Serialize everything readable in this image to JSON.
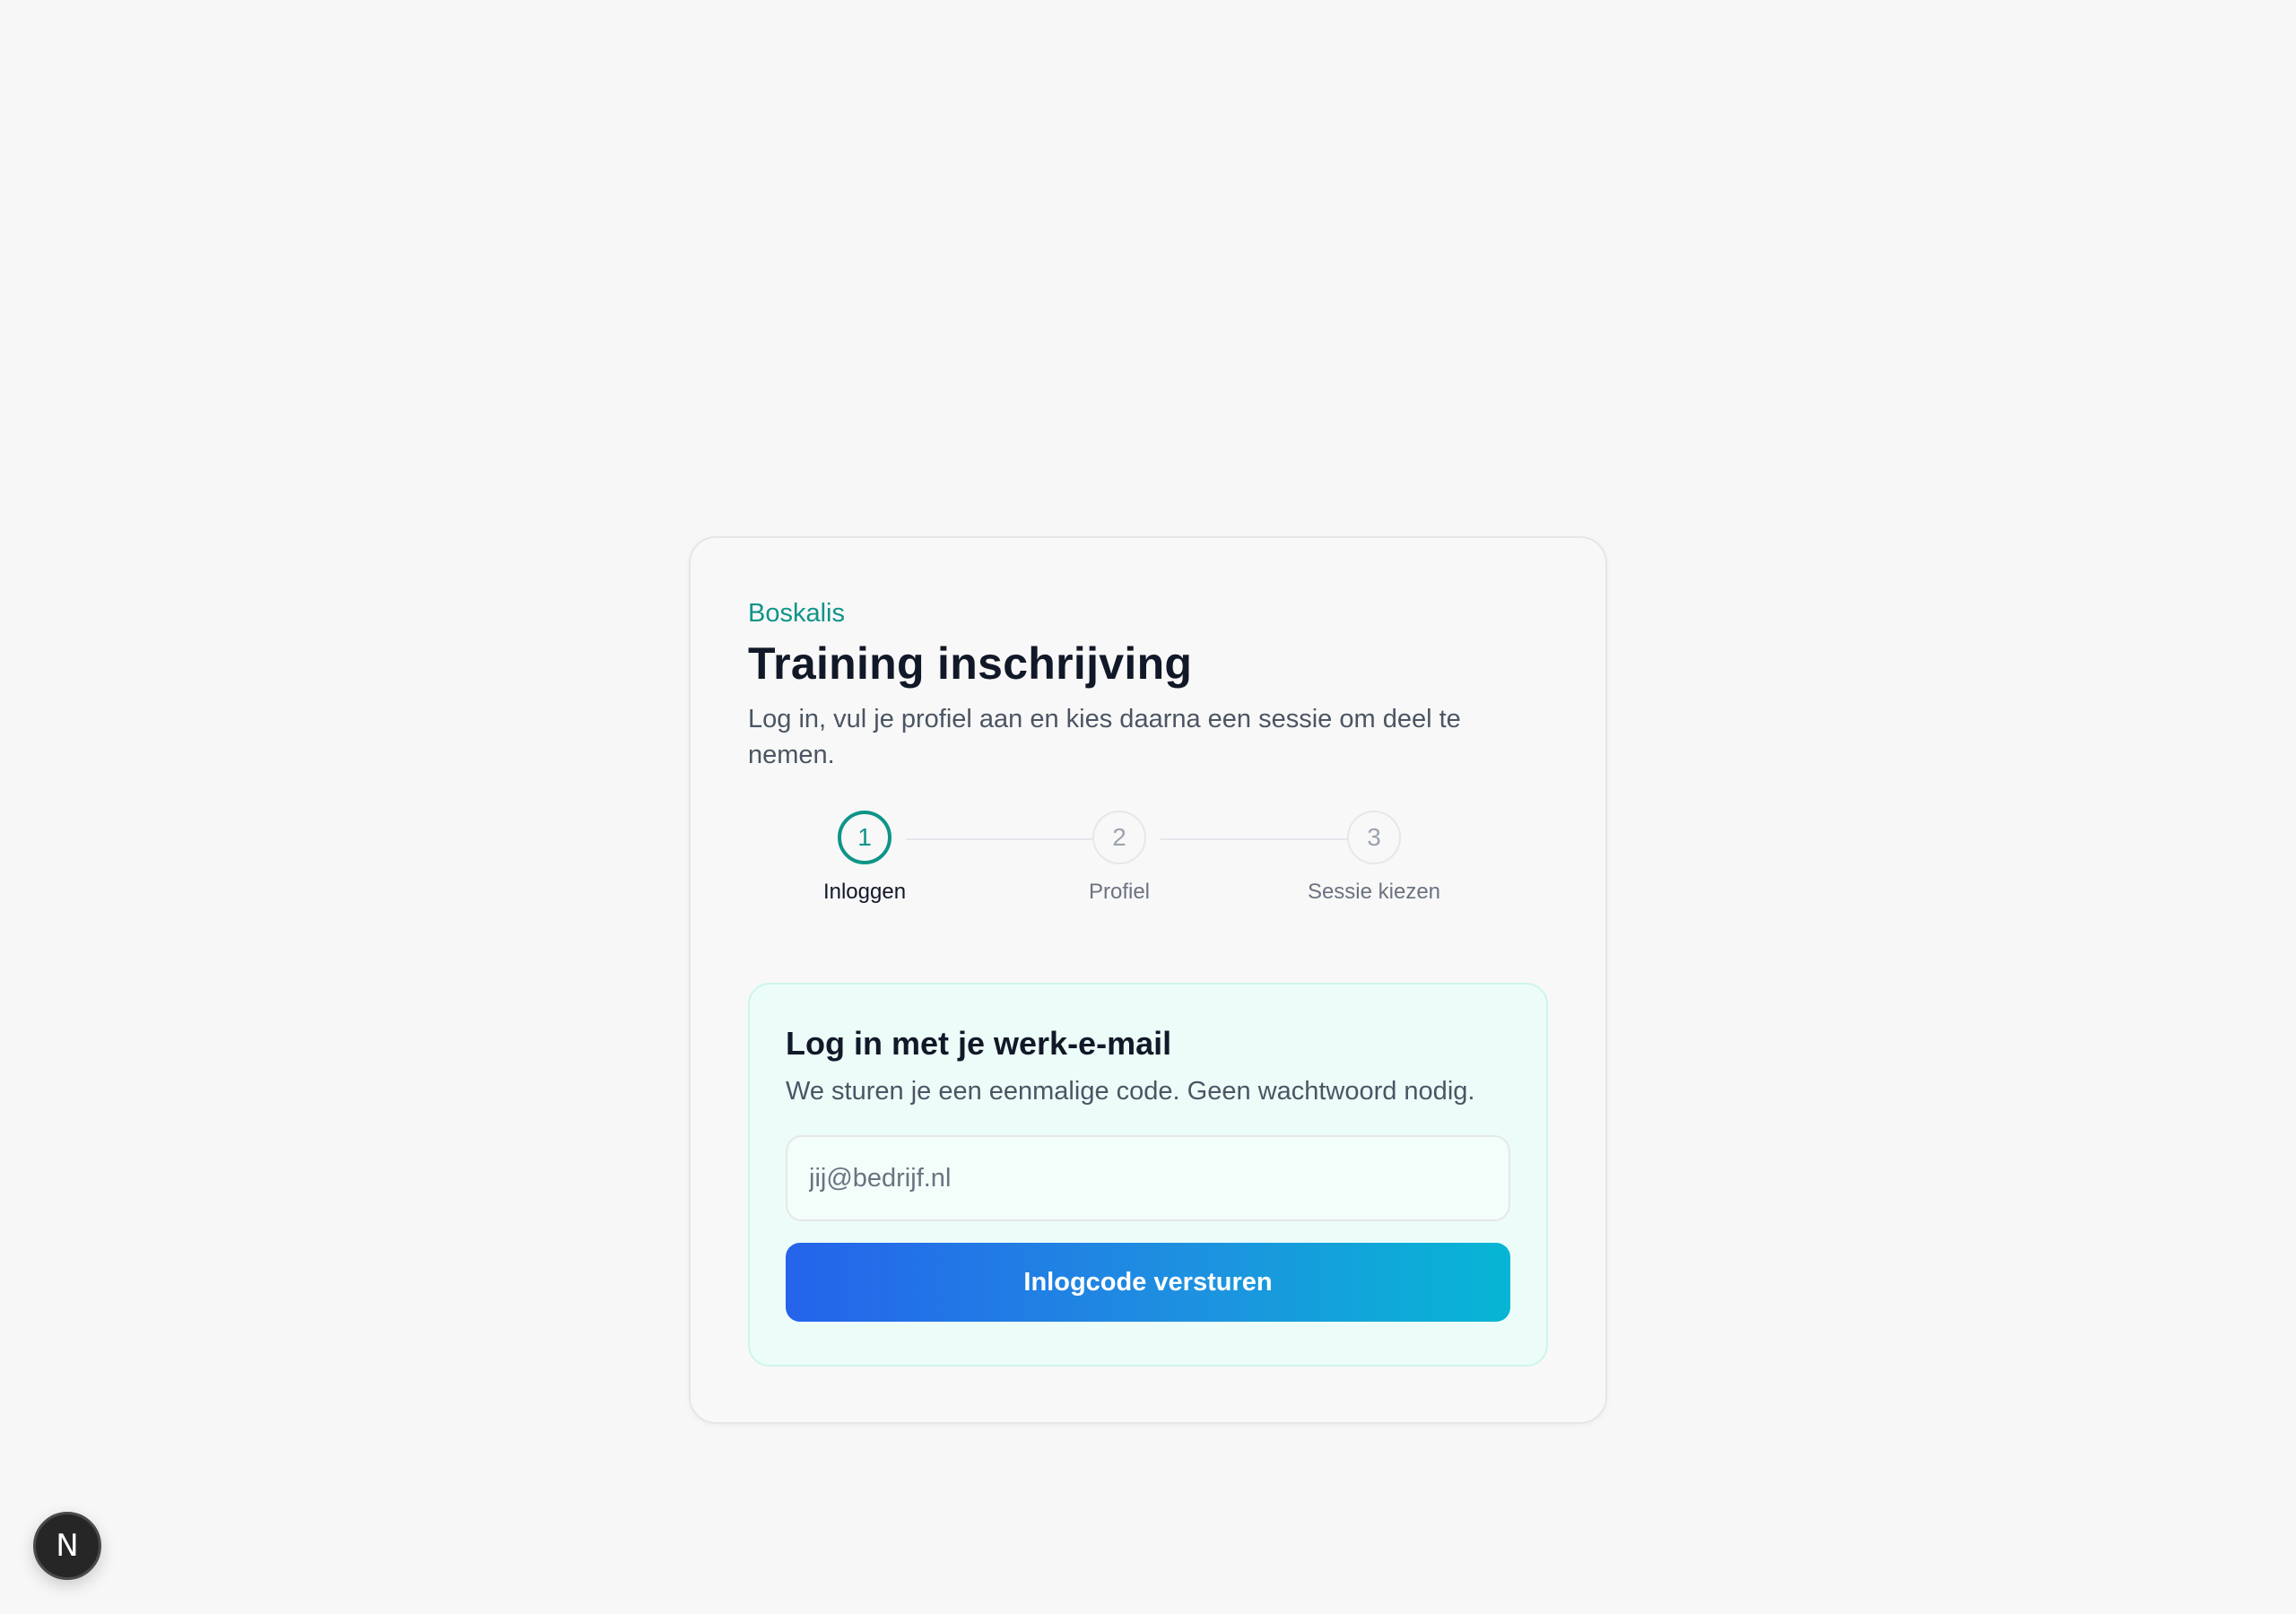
{
  "card": {
    "brand": "Boskalis",
    "title": "Training inschrijving",
    "subtitle": "Log in, vul je profiel aan en kies daarna een sessie om deel te nemen."
  },
  "stepper": {
    "steps": [
      {
        "number": "1",
        "label": "Inloggen",
        "active": true
      },
      {
        "number": "2",
        "label": "Profiel",
        "active": false
      },
      {
        "number": "3",
        "label": "Sessie kiezen",
        "active": false
      }
    ]
  },
  "login": {
    "heading": "Log in met je werk-e-mail",
    "description": "We sturen je een eenmalige code. Geen wachtwoord nodig.",
    "email_placeholder": "jij@bedrijf.nl",
    "email_value": "",
    "submit_label": "Inlogcode versturen"
  },
  "dev_badge": {
    "letter": "N",
    "icon": "nextjs-logo-icon"
  },
  "colors": {
    "background": "#f7f7f7",
    "accent": "#0f9488",
    "button_gradient_start": "#2563eb",
    "button_gradient_end": "#06b6d4",
    "login_box_background": "#ecfdf9"
  }
}
